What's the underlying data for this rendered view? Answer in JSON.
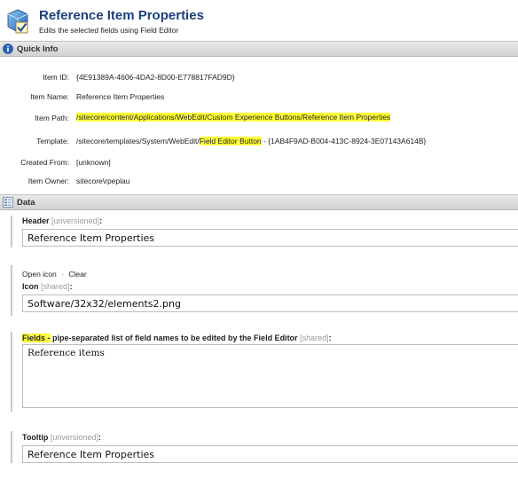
{
  "header": {
    "title": "Reference Item Properties",
    "subtitle": "Edits the selected fields using Field Editor"
  },
  "quick_info": {
    "section_title": "Quick Info",
    "rows": [
      {
        "label": "Item ID:",
        "value": "{4E91389A-4606-4DA2-8D00-E778817FAD9D}"
      },
      {
        "label": "Item Name:",
        "value": "Reference Item Properties"
      },
      {
        "label": "Item Path:",
        "value": "/sitecore/content/Applications/WebEdit/Custom Experience Buttons/Reference Item Properties"
      },
      {
        "label": "Template:",
        "value_part1": "/sitecore/templates/System/WebEdit/",
        "value_part2": "Field Editor Button",
        "value_part3": " - {1AB4F9AD-B004-413C-8924-3E07143A614B}"
      },
      {
        "label": "Created From:",
        "value": "[unknown]"
      },
      {
        "label": "Item Owner:",
        "value": "sitecore\\rpeplau"
      }
    ]
  },
  "data_section": {
    "section_title": "Data",
    "header_field": {
      "label": "Header",
      "scope": "[unversioned]",
      "colon": ":",
      "value": "Reference Item Properties"
    },
    "icon_field": {
      "open_icon": "Open icon",
      "separator": "·",
      "clear": "Clear",
      "label": "Icon",
      "scope": "[shared]",
      "colon": ":",
      "value": "Software/32x32/elements2.png"
    },
    "fields_field": {
      "label": "Fields -",
      "description": " pipe-separated list of field names to be edited by the Field Editor",
      "scope": "[shared]",
      "colon": ":",
      "value": "Reference items"
    },
    "tooltip_field": {
      "label": "Tooltip",
      "scope": "[unversioned]",
      "colon": ":",
      "value": "Reference Item Properties"
    }
  },
  "colors": {
    "highlight": "#ffff3a",
    "title": "#1c3f7c",
    "section_bar": "#d8d8d8"
  }
}
